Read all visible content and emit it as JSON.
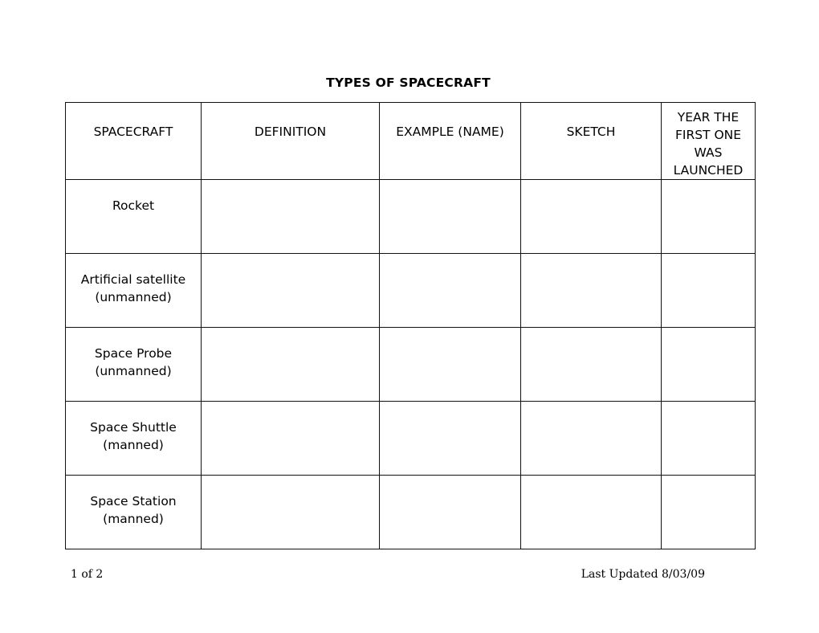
{
  "document": {
    "title": "TYPES OF SPACECRAFT"
  },
  "table": {
    "headers": [
      "SPACECRAFT",
      "DEFINITION",
      "EXAMPLE (NAME)",
      "SKETCH",
      "YEAR THE FIRST ONE WAS LAUNCHED"
    ],
    "rows": [
      {
        "spacecraft": "Rocket",
        "definition": "",
        "example": "",
        "sketch": "",
        "year": ""
      },
      {
        "spacecraft": "Artificial satellite (unmanned)",
        "definition": "",
        "example": "",
        "sketch": "",
        "year": ""
      },
      {
        "spacecraft": "Space Probe (unmanned)",
        "definition": "",
        "example": "",
        "sketch": "",
        "year": ""
      },
      {
        "spacecraft": "Space Shuttle (manned)",
        "definition": "",
        "example": "",
        "sketch": "",
        "year": ""
      },
      {
        "spacecraft": "Space Station (manned)",
        "definition": "",
        "example": "",
        "sketch": "",
        "year": ""
      }
    ]
  },
  "footer": {
    "page_number": "1 of 2",
    "last_updated": "Last Updated 8/03/09"
  },
  "colors": {
    "page_background": "#ffffff",
    "text": "#000000",
    "table_border": "#111111"
  }
}
